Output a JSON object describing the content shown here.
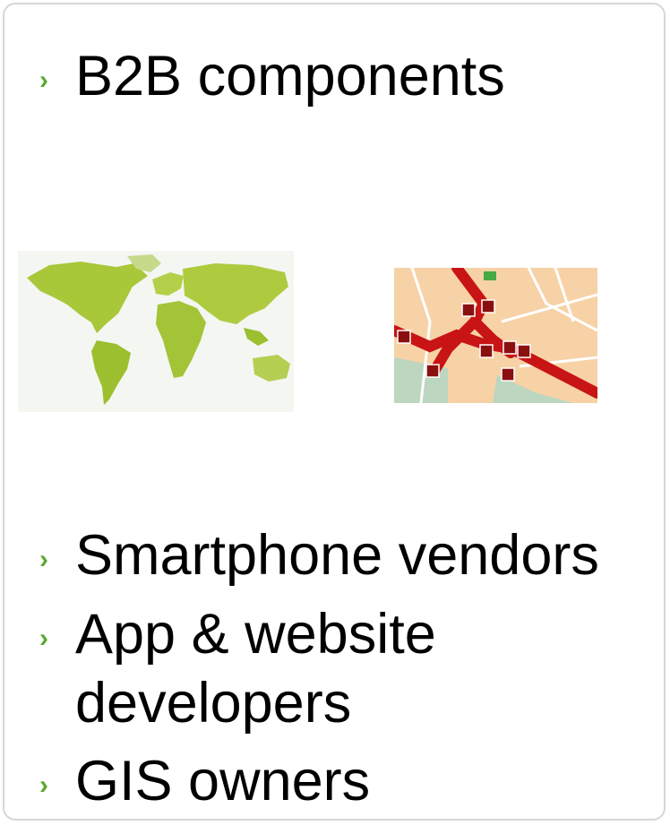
{
  "bullets": [
    {
      "text": "B2B components"
    },
    {
      "text": "Smartphone vendors"
    },
    {
      "text": "App & website"
    },
    {
      "text": "developers"
    },
    {
      "text": "GIS owners"
    }
  ],
  "colors": {
    "bullet": "#5aa832",
    "border": "#d6d6d6",
    "map_green": "#a6c832",
    "road_red": "#cc1010",
    "map_bg": "#f7d2a6"
  },
  "icons": {
    "bullet": "chevron-right-icon"
  }
}
